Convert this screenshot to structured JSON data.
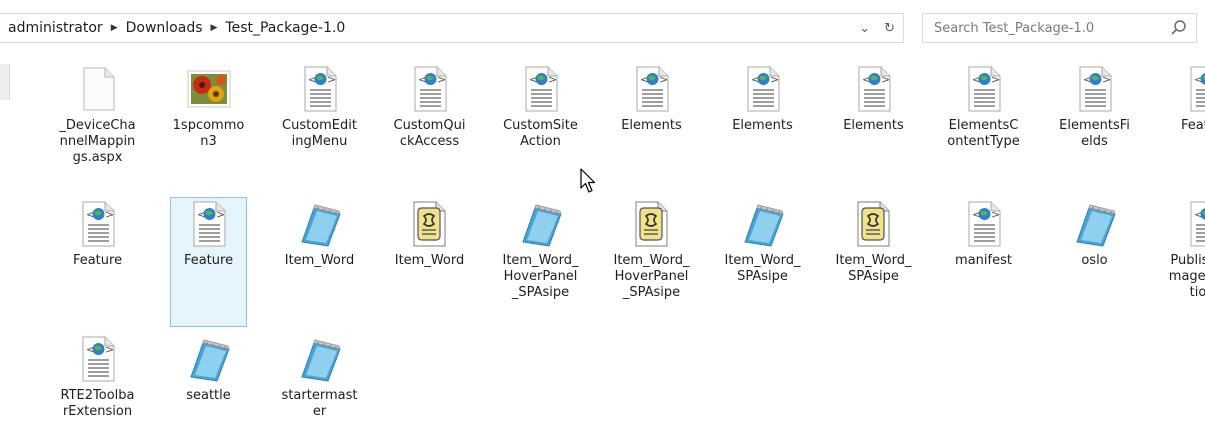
{
  "address": {
    "crumbs": [
      "administrator",
      "Downloads",
      "Test_Package-1.0"
    ],
    "history_glyph": "⌄",
    "refresh_glyph": "↻"
  },
  "search": {
    "placeholder": "Search Test_Package-1.0"
  },
  "files": [
    {
      "name": "_DeviceChannelMappings.aspx",
      "icon": "blank"
    },
    {
      "name": "1spcommon3",
      "icon": "image"
    },
    {
      "name": "CustomEditingMenu",
      "icon": "xml"
    },
    {
      "name": "CustomQuickAccess",
      "icon": "xml"
    },
    {
      "name": "CustomSiteAction",
      "icon": "xml"
    },
    {
      "name": "Elements",
      "icon": "xml"
    },
    {
      "name": "Elements",
      "icon": "xml"
    },
    {
      "name": "Elements",
      "icon": "xml"
    },
    {
      "name": "ElementsContentType",
      "icon": "xml"
    },
    {
      "name": "ElementsFields",
      "icon": "xml"
    },
    {
      "name": "Feature",
      "icon": "xml"
    },
    {
      "name": "Feature",
      "icon": "xml"
    },
    {
      "name": "Feature",
      "icon": "xml",
      "selected": true
    },
    {
      "name": "Item_Word",
      "icon": "notepad"
    },
    {
      "name": "Item_Word",
      "icon": "script"
    },
    {
      "name": "Item_Word_HoverPanel_SPAsipe",
      "icon": "notepad"
    },
    {
      "name": "Item_Word_HoverPanel_SPAsipe",
      "icon": "script"
    },
    {
      "name": "Item_Word_SPAsipe",
      "icon": "notepad"
    },
    {
      "name": "Item_Word_SPAsipe",
      "icon": "script"
    },
    {
      "name": "manifest",
      "icon": "xml"
    },
    {
      "name": "oslo",
      "icon": "notepad"
    },
    {
      "name": "PublishingImageRenditions",
      "icon": "xml"
    },
    {
      "name": "RTE2ToolbarExtension",
      "icon": "xml"
    },
    {
      "name": "seattle",
      "icon": "notepad"
    },
    {
      "name": "startermaster",
      "icon": "notepad"
    }
  ]
}
